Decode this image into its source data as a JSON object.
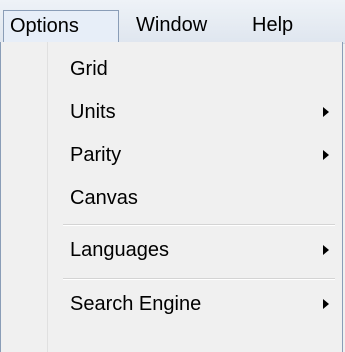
{
  "menubar": {
    "items": [
      {
        "label": "Options"
      },
      {
        "label": "Window"
      },
      {
        "label": "Help"
      }
    ]
  },
  "menu": {
    "items": [
      {
        "label": "Grid",
        "has_submenu": false
      },
      {
        "label": "Units",
        "has_submenu": true
      },
      {
        "label": "Parity",
        "has_submenu": true
      },
      {
        "label": "Canvas",
        "has_submenu": false
      },
      {
        "label": "Languages",
        "has_submenu": true
      },
      {
        "label": "Search Engine",
        "has_submenu": true
      }
    ]
  },
  "colors": {
    "menubar_bg": "#e4eaf2",
    "menu_bg": "#f0f0f0",
    "border": "#8a9db7"
  }
}
